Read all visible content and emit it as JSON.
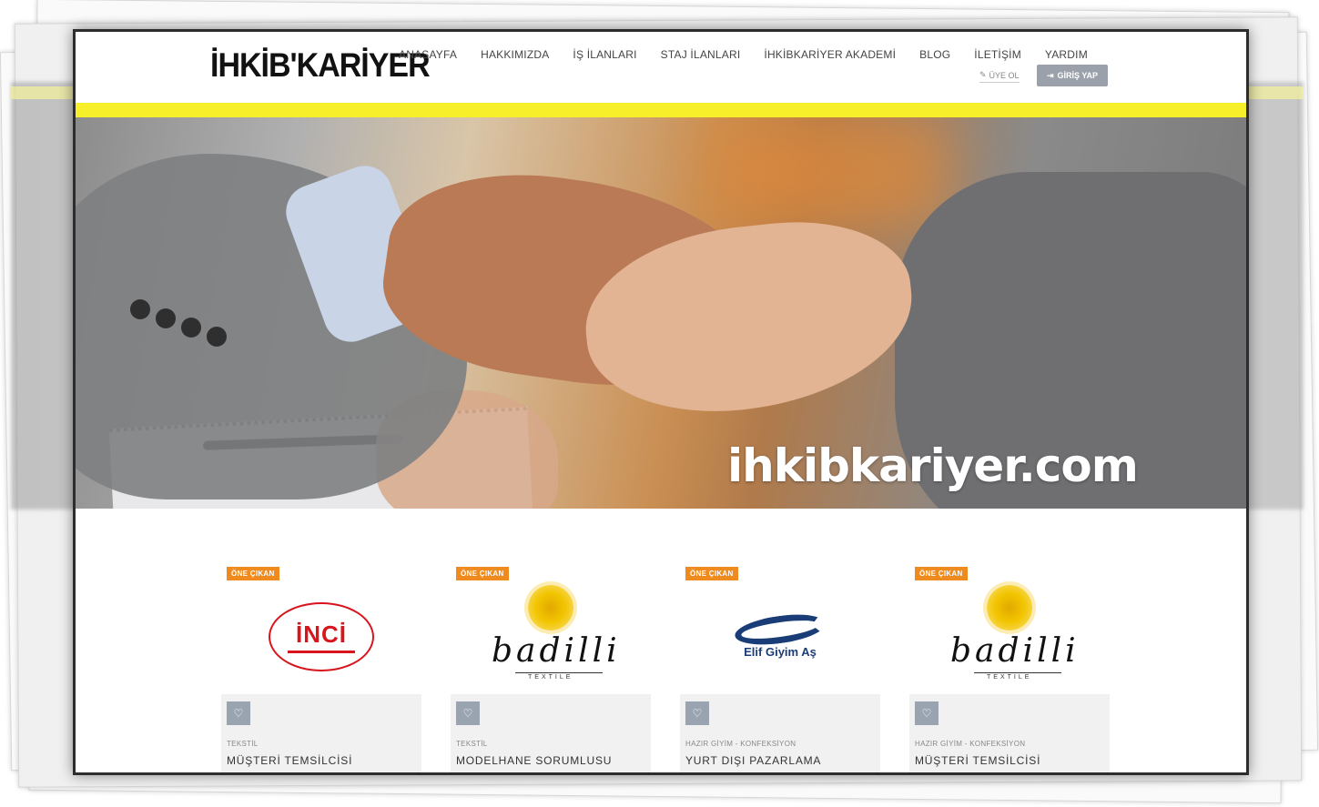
{
  "header": {
    "logo": "İHKİB'KARİYER",
    "nav": [
      "ANASAYFA",
      "HAKKIMIZDA",
      "İŞ İLANLARI",
      "STAJ İLANLARI",
      "İHKİBKARİYER AKADEMİ",
      "BLOG",
      "İLETİŞİM",
      "YARDIM"
    ],
    "signup_label": "ÜYE OL",
    "login_label": "GİRİŞ YAP"
  },
  "hero": {
    "text": "ihkibkariyer.com"
  },
  "cards": [
    {
      "badge": "ÖNE ÇIKAN",
      "company_logo": "İNCİ",
      "category": "TEKSTİL",
      "title": "MÜŞTERİ TEMSİLCİSİ"
    },
    {
      "badge": "ÖNE ÇIKAN",
      "company_logo": "badilli",
      "logo_sub": "TEXTILE",
      "category": "TEKSTİL",
      "title": "MODELHANE SORUMLUSU"
    },
    {
      "badge": "ÖNE ÇIKAN",
      "company_logo": "Elif Giyim Aş",
      "category": "HAZIR GİYİM - KONFEKSİYON",
      "title": "YURT DIŞI PAZARLAMA"
    },
    {
      "badge": "ÖNE ÇIKAN",
      "company_logo": "badilli",
      "logo_sub": "TEXTILE",
      "category": "HAZIR GİYİM - KONFEKSİYON",
      "title": "MÜŞTERİ TEMSİLCİSİ"
    }
  ],
  "colors": {
    "accent_yellow": "#f7ef2a",
    "badge_orange": "#ef8a1f",
    "login_button": "#9aa1aa"
  }
}
